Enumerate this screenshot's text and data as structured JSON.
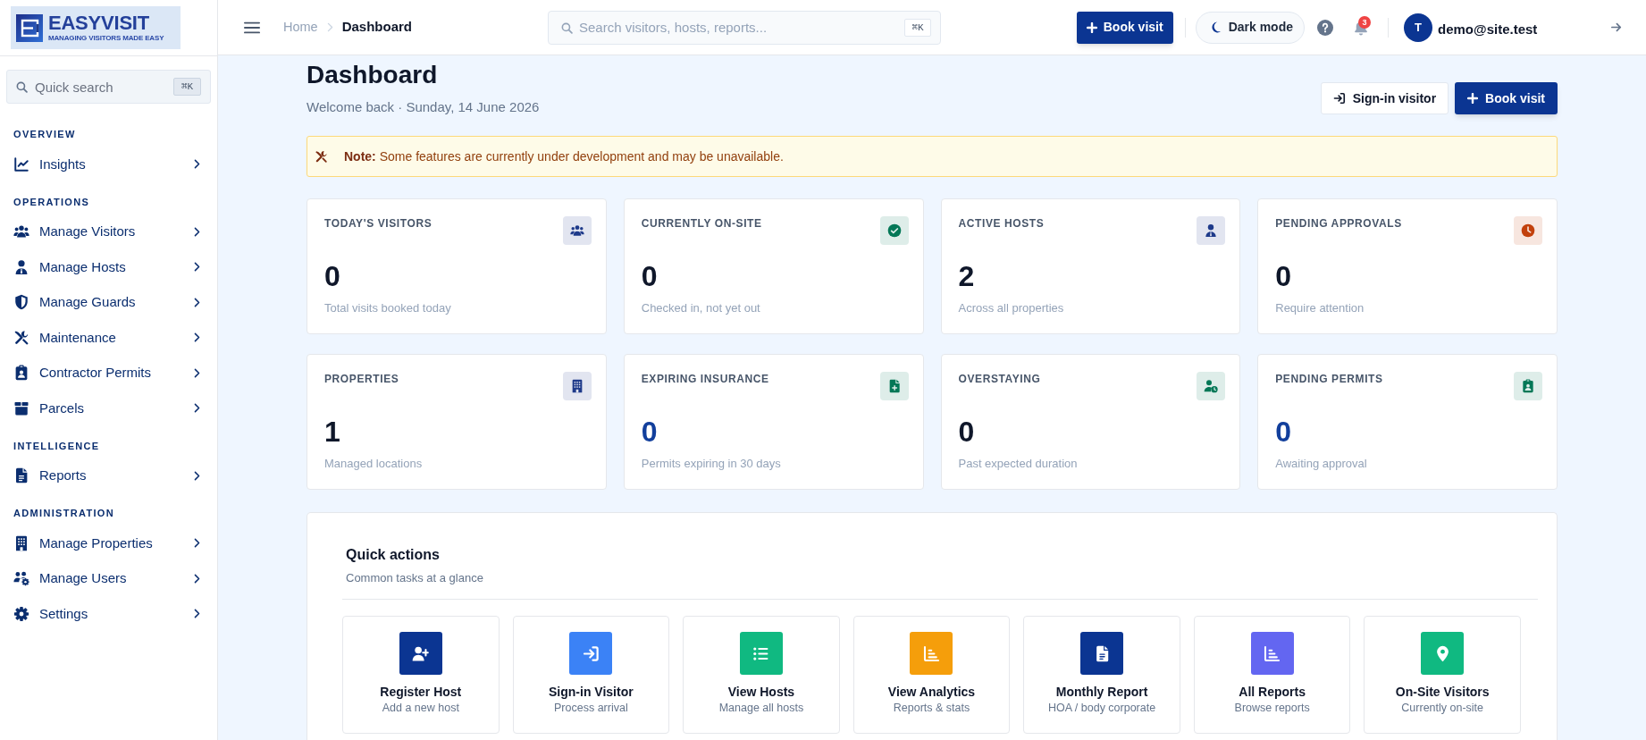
{
  "sidebar": {
    "logo": {
      "wordmark": "EASYVISIT",
      "tagline": "MANAGING VISITORS MADE EASY"
    },
    "search": {
      "placeholder": "Quick search",
      "shortcut": "⌘K"
    },
    "sections": [
      {
        "title": "OVERVIEW",
        "items": [
          {
            "label": "Insights",
            "selected": false,
            "expanded": false
          }
        ]
      },
      {
        "title": "OPERATIONS",
        "items": [
          {
            "label": "Manage Visitors",
            "selected": false,
            "expanded": false
          },
          {
            "label": "Manage Hosts",
            "selected": false,
            "expanded": false
          },
          {
            "label": "Manage Guards",
            "selected": false,
            "expanded": false
          },
          {
            "label": "Maintenance",
            "selected": false,
            "expanded": false
          },
          {
            "label": "Contractor Permits",
            "selected": false,
            "expanded": false
          },
          {
            "label": "Parcels",
            "selected": false,
            "expanded": false
          }
        ]
      },
      {
        "title": "INTELLIGENCE",
        "items": [
          {
            "label": "Reports",
            "selected": false,
            "expanded": false
          }
        ]
      },
      {
        "title": "ADMINISTRATION",
        "items": [
          {
            "label": "Manage Properties",
            "selected": false,
            "expanded": false
          },
          {
            "label": "Manage Users",
            "selected": false,
            "expanded": false
          },
          {
            "label": "Settings",
            "selected": false,
            "expanded": false
          }
        ]
      }
    ]
  },
  "header": {
    "breadcrumb": [
      {
        "label": "Home",
        "current": false
      },
      {
        "label": "Dashboard",
        "current": true
      }
    ],
    "search": {
      "placeholder": "Search visitors, hosts, reports...",
      "shortcut": "⌘K"
    },
    "book_button": "Book visit",
    "theme_button": "Dark mode",
    "notification_count": "3",
    "user": {
      "initial": "T",
      "email": "demo@site.test"
    }
  },
  "page": {
    "title": "Dashboard",
    "subtitle": "Welcome back · Sunday, 14 June 2026",
    "actions": [
      {
        "label": "Sign-in visitor",
        "kind": "secondary"
      },
      {
        "label": "Book visit",
        "kind": "primary"
      }
    ]
  },
  "notice": {
    "text": "**Note:** Some features are currently under development and may be unavailable."
  },
  "stats": [
    {
      "label": "TODAY'S VISITORS",
      "value": "0",
      "caption": "Total visits booked today",
      "color": "#1e3a8a",
      "highlighted": false
    },
    {
      "label": "CURRENTLY ON-SITE",
      "value": "0",
      "caption": "Checked in, not yet out",
      "color": "#047857",
      "highlighted": false
    },
    {
      "label": "ACTIVE HOSTS",
      "value": "2",
      "caption": "Across all properties",
      "color": "#1e3a8a",
      "highlighted": false
    },
    {
      "label": "PENDING APPROVALS",
      "value": "0",
      "caption": "Require attention",
      "color": "#c2410c",
      "highlighted": false
    },
    {
      "label": "PROPERTIES",
      "value": "1",
      "caption": "Managed locations",
      "color": "#1e3a8a",
      "highlighted": false
    },
    {
      "label": "EXPIRING INSURANCE",
      "value": "0",
      "caption": "Permits expiring in 30 days",
      "color": "#047857",
      "highlighted": true
    },
    {
      "label": "OVERSTAYING",
      "value": "0",
      "caption": "Past expected duration",
      "color": "#047857",
      "highlighted": false
    },
    {
      "label": "PENDING PERMITS",
      "value": "0",
      "caption": "Awaiting approval",
      "color": "#047857",
      "highlighted": true
    }
  ],
  "quick_actions": {
    "title": "Quick actions",
    "subtitle": "Common tasks at a glance",
    "items": [
      {
        "label": "Register Host",
        "caption": "Add a new host",
        "color": "#0b3592"
      },
      {
        "label": "Sign-in Visitor",
        "caption": "Process arrival",
        "color": "#3b82f6"
      },
      {
        "label": "View Hosts",
        "caption": "Manage all hosts",
        "color": "#10b981"
      },
      {
        "label": "View Analytics",
        "caption": "Reports & stats",
        "color": "#f59e0b"
      },
      {
        "label": "Monthly Report",
        "caption": "HOA / body corporate",
        "color": "#0b3592"
      },
      {
        "label": "All Reports",
        "caption": "Browse reports",
        "color": "#6366f1"
      },
      {
        "label": "On-Site Visitors",
        "caption": "Currently on-site",
        "color": "#10b981"
      }
    ]
  }
}
